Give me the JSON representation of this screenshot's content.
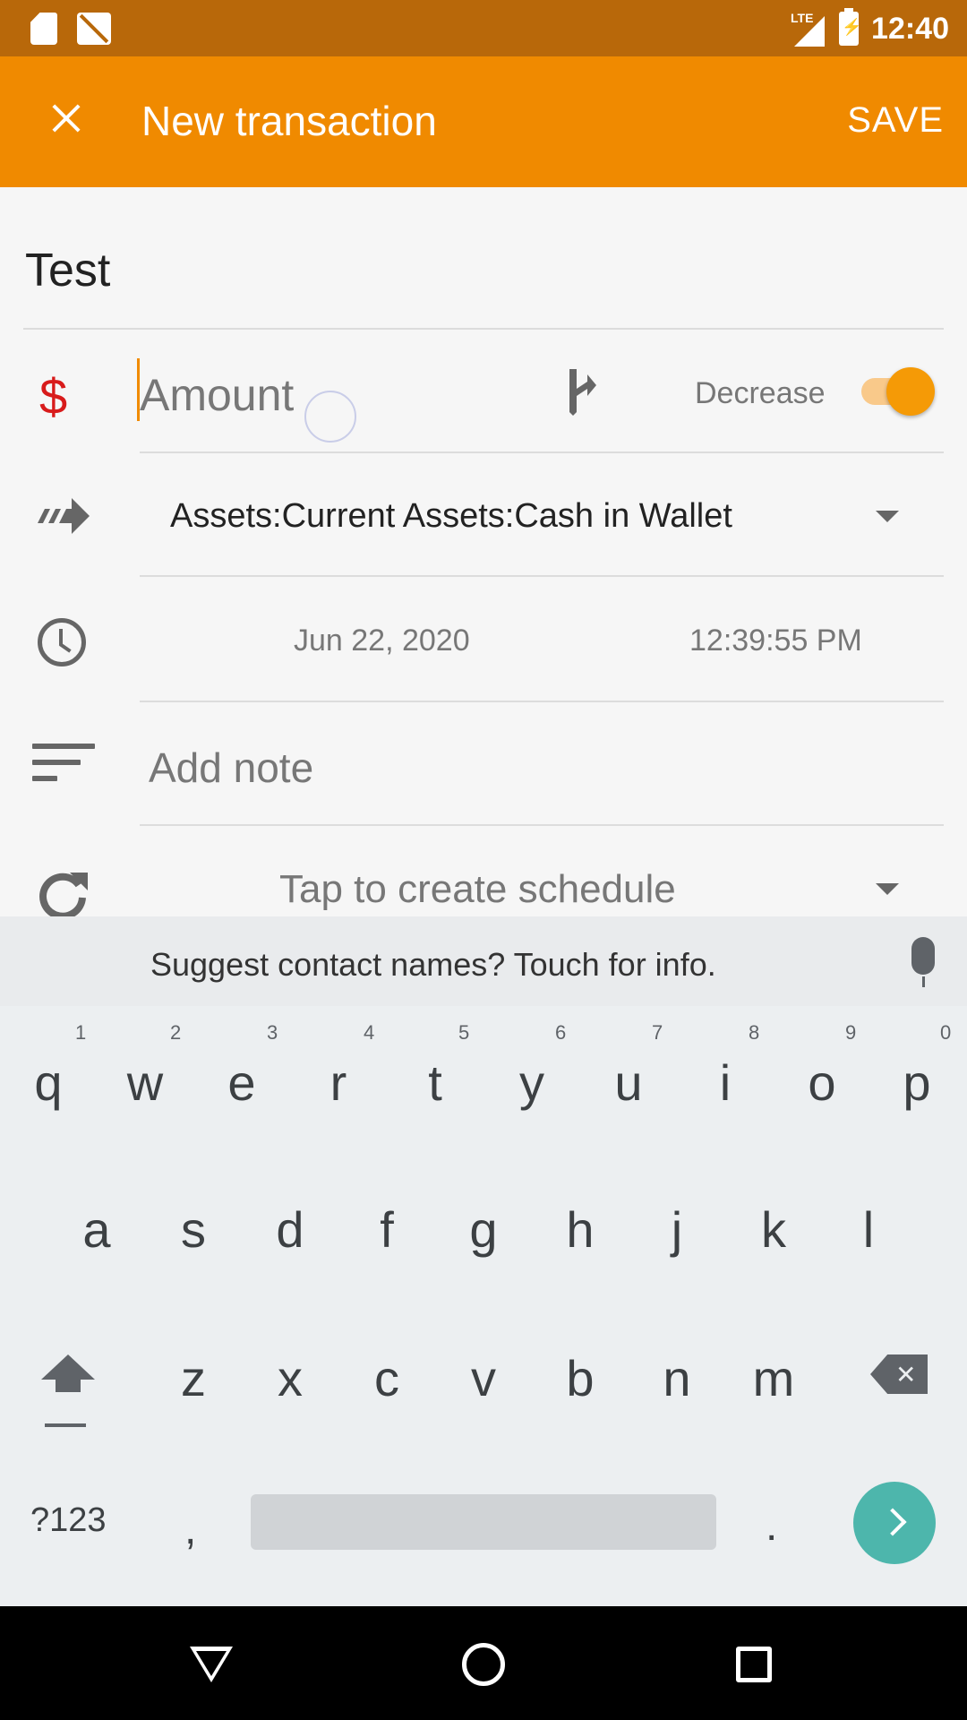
{
  "status_bar": {
    "network": "LTE",
    "time": "12:40"
  },
  "app_bar": {
    "title": "New transaction",
    "save_label": "SAVE"
  },
  "form": {
    "description": "Test",
    "amount_placeholder": "Amount",
    "type_label": "Decrease",
    "account": "Assets:Current Assets:Cash in Wallet",
    "date": "Jun 22, 2020",
    "time": "12:39:55 PM",
    "note_placeholder": "Add note",
    "schedule_placeholder": "Tap to create schedule"
  },
  "keyboard": {
    "suggestion": "Suggest contact names? Touch for info.",
    "row1": [
      "q",
      "w",
      "e",
      "r",
      "t",
      "y",
      "u",
      "i",
      "o",
      "p"
    ],
    "row1_hints": [
      "1",
      "2",
      "3",
      "4",
      "5",
      "6",
      "7",
      "8",
      "9",
      "0"
    ],
    "row2": [
      "a",
      "s",
      "d",
      "f",
      "g",
      "h",
      "j",
      "k",
      "l"
    ],
    "row3": [
      "z",
      "x",
      "c",
      "v",
      "b",
      "n",
      "m"
    ],
    "symbols_label": "?123",
    "comma": ",",
    "period": "."
  },
  "colors": {
    "accent": "#f08a00",
    "status_bar": "#b8680a",
    "amount_icon": "#d81b1b",
    "enter_key": "#4db6ac"
  },
  "icons": [
    "sd-card-icon",
    "no-image-icon",
    "lte-signal-icon",
    "battery-charging-icon",
    "close-icon",
    "dollar-icon",
    "split-icon",
    "transfer-icon",
    "clock-icon",
    "notes-icon",
    "repeat-icon",
    "mic-icon",
    "shift-icon",
    "backspace-icon",
    "enter-icon",
    "back-icon",
    "home-icon",
    "recents-icon"
  ]
}
